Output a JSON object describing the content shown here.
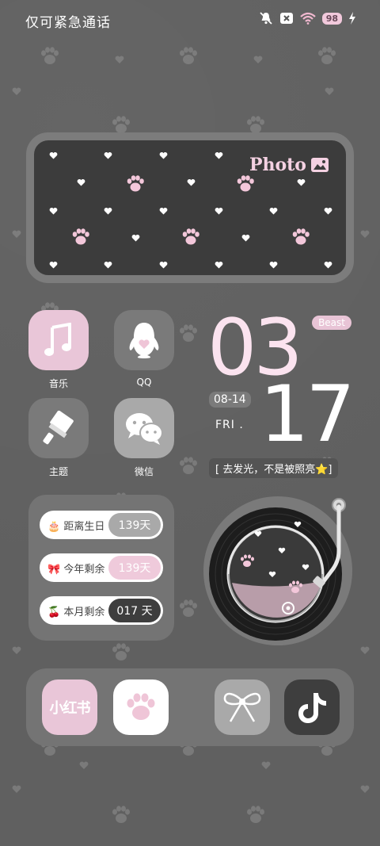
{
  "status_bar": {
    "carrier_text": "仅可紧急通话",
    "battery_level": "98",
    "icons": [
      "mute-bell-icon",
      "sim-blocked-icon",
      "wifi-icon",
      "battery-icon",
      "charging-icon"
    ]
  },
  "photo_widget": {
    "label": "Photo",
    "icon": "image-icon"
  },
  "apps": [
    {
      "name": "音乐",
      "icon": "music-note-icon",
      "color": "#e9c6d8"
    },
    {
      "name": "QQ",
      "icon": "penguin-icon",
      "color": "#7a7a7a"
    },
    {
      "name": "主题",
      "icon": "paint-brush-icon",
      "color": "#7a7a7a"
    },
    {
      "name": "微信",
      "icon": "chat-bubbles-icon",
      "color": "#a9a9a9"
    }
  ],
  "clock": {
    "hour": "03",
    "minute": "17",
    "badge": "Beast",
    "date": "08-14",
    "weekday": "FRI ."
  },
  "quote": "[ 去发光，不是被照亮⭐]",
  "countdown": {
    "rows": [
      {
        "label": "距离生日",
        "value": "139天",
        "emoji": "🎂",
        "pill_color": "#a9a9a9",
        "text_color": "#fff"
      },
      {
        "label": "今年剩余",
        "value": "139天",
        "emoji": "🎀",
        "pill_color": "#efcadb",
        "text_color": "#fff"
      },
      {
        "label": "本月剩余",
        "value": "017 天",
        "emoji": "🍒",
        "pill_color": "#3e3e3e",
        "text_color": "#fff"
      }
    ]
  },
  "dock": [
    {
      "name": "xiaohongshu",
      "text": "小红书",
      "color": "#e9c6d8"
    },
    {
      "name": "paw-app",
      "icon": "paw-icon",
      "color": "#ffffff"
    },
    {
      "name": "bow-app",
      "icon": "bow-icon",
      "color": "#a9a9a9"
    },
    {
      "name": "tiktok",
      "icon": "tiktok-icon",
      "color": "#3e3e3e"
    }
  ]
}
